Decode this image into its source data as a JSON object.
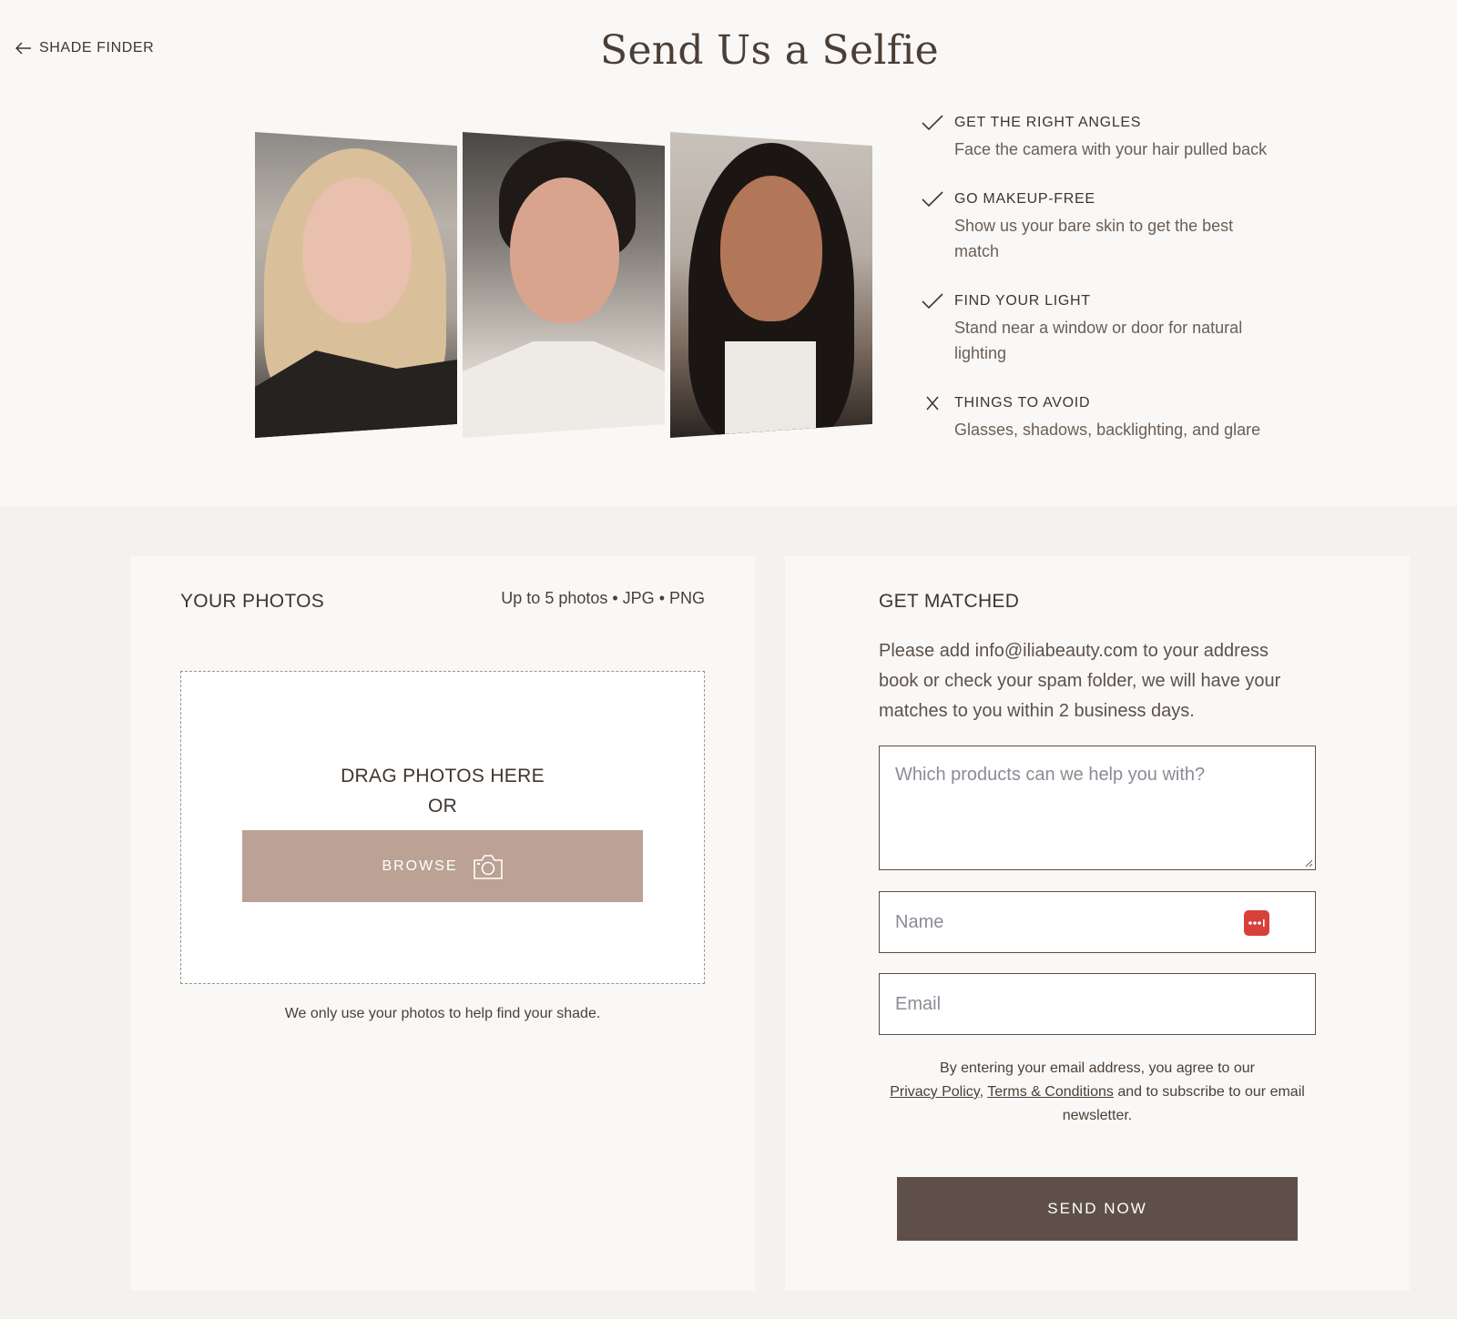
{
  "nav": {
    "back_label": "SHADE FINDER",
    "back_icon": "arrow-left-icon"
  },
  "header": {
    "title": "Send Us a Selfie"
  },
  "photos": [
    {
      "name": "selfie-example-1"
    },
    {
      "name": "selfie-example-2"
    },
    {
      "name": "selfie-example-3"
    }
  ],
  "tips": [
    {
      "icon": "check-icon",
      "heading": "GET THE RIGHT ANGLES",
      "description": "Face the camera with your hair pulled back"
    },
    {
      "icon": "check-icon",
      "heading": "GO MAKEUP-FREE",
      "description": "Show us your bare skin to get the best match"
    },
    {
      "icon": "check-icon",
      "heading": "FIND YOUR LIGHT",
      "description": "Stand near a window or door for natural lighting"
    },
    {
      "icon": "close-icon",
      "heading": "THINGS TO AVOID",
      "description": "Glasses, shadows, backlighting, and glare"
    }
  ],
  "your_photos": {
    "title": "YOUR PHOTOS",
    "limits": "Up to 5 photos • JPG • PNG",
    "drop_line1": "DRAG PHOTOS HERE",
    "drop_line2": "OR",
    "browse_label": "BROWSE",
    "browse_icon": "camera-icon",
    "note": "We only use your photos to help find your shade."
  },
  "get_matched": {
    "title": "GET MATCHED",
    "description": "Please add info@iliabeauty.com to your address book or check your spam folder, we will have your matches to you within 2 business days.",
    "products_placeholder": "Which products can we help you with?",
    "name_placeholder": "Name",
    "email_placeholder": "Email",
    "password_manager_icon": "password-manager-icon",
    "consent_prefix": "By entering your email address, you agree to our",
    "privacy_link": "Privacy Policy",
    "terms_link": "Terms & Conditions",
    "consent_suffix": "and to subscribe to our email newsletter.",
    "submit_label": "SEND NOW"
  },
  "colors": {
    "browse_button": "#bba294",
    "send_button": "#5e5048",
    "password_icon": "#d8403a"
  }
}
